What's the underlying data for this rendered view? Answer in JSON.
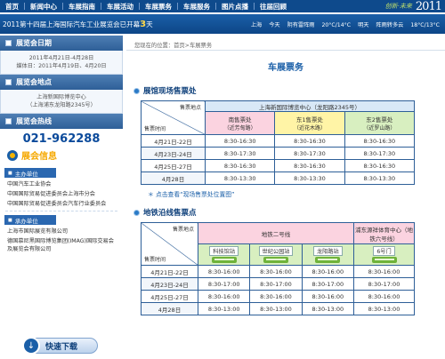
{
  "nav": {
    "items": [
      "首页",
      "新闻中心",
      "车展指南",
      "车展活动",
      "车展票务",
      "车展服务",
      "图片点播",
      "往届回顾"
    ],
    "brand_tagline": "创新·未来",
    "brand_year": "2011"
  },
  "infobar": {
    "countdown_prefix": "2011第十四届上海国际汽车工业展览会已开幕",
    "countdown_days": "3",
    "countdown_suffix": "天",
    "weather": [
      "上海",
      "今天",
      "阴有雷阵雨",
      "20°C/14°C",
      "明天",
      "阵雨转多云",
      "18°C/13°C"
    ]
  },
  "sidebar": {
    "dates_heading": "展览会日期",
    "dates_lines": [
      "2011年4月21日-4月28日",
      "媒体日：2011年4月19日、4月20日"
    ],
    "venue_heading": "展览会地点",
    "venue_lines": [
      "上海新国际博览中心",
      "（上海浦东龙阳路2345号）"
    ],
    "hotline_heading": "展览会热线",
    "hotline_number": "021-962288",
    "info_title": "展会信息",
    "organizer_heading": "主办单位",
    "organizers": [
      "中国汽车工业协会",
      "中国国际贸易促进委员会上海市分会",
      "中国国际贸易促进委员会汽车行业委员会"
    ],
    "contractor_heading": "承办单位",
    "contractors": [
      "上海市国际展览有限公司",
      "德国慕尼黑国际博览集团(IMAG)国际交易会及展览会有限公司"
    ],
    "download_label": "快速下载"
  },
  "main": {
    "breadcrumb": "您现在的位置：首页>车展票务",
    "title": "车展票务",
    "section1_title": "展馆现场售票处",
    "section2_title": "地铁沿线售票点",
    "link_text": "＊ 点击查看“现场售票处位置图”"
  },
  "table1": {
    "corner_top": "售票地点",
    "corner_bottom": "售票时间",
    "group_header": "上海新国际博览中心（龙阳路2345号）",
    "locations": [
      {
        "name": "南售票处",
        "sub": "（近芳甸路）"
      },
      {
        "name": "东1售票处",
        "sub": "（近花木路）"
      },
      {
        "name": "东2售票处",
        "sub": "（近罗山路）"
      }
    ],
    "rows": [
      {
        "date": "4月21日-22日",
        "times": [
          "8:30-16:30",
          "8:30-16:30",
          "8:30-16:30"
        ]
      },
      {
        "date": "4月23日-24日",
        "times": [
          "8:30-17:30",
          "8:30-17:30",
          "8:30-17:30"
        ]
      },
      {
        "date": "4月25日-27日",
        "times": [
          "8:30-16:30",
          "8:30-16:30",
          "8:30-16:30"
        ]
      },
      {
        "date": "4月28日",
        "times": [
          "8:30-13:30",
          "8:30-13:30",
          "8:30-13:30"
        ]
      }
    ]
  },
  "table2": {
    "corner_top": "售票地点",
    "corner_bottom": "售票时间",
    "group_header_1": "地铁二号线",
    "group_header_2": "浦东源祥体育中心（地铁六号线）",
    "stations": [
      "科技馆站",
      "世纪公园站",
      "龙阳路站",
      "6号门"
    ],
    "rows": [
      {
        "date": "4月21日-22日",
        "times": [
          "8:30-16:00",
          "8:30-16:00",
          "8:30-16:00",
          "8:30-16:00"
        ]
      },
      {
        "date": "4月23日-24日",
        "times": [
          "8:30-17:00",
          "8:30-17:00",
          "8:30-17:00",
          "8:30-17:00"
        ]
      },
      {
        "date": "4月25日-27日",
        "times": [
          "8:30-16:00",
          "8:30-16:00",
          "8:30-16:00",
          "8:30-16:00"
        ]
      },
      {
        "date": "4月28日",
        "times": [
          "8:30-13:00",
          "8:30-13:00",
          "8:30-13:00",
          "8:30-13:00"
        ]
      }
    ]
  }
}
